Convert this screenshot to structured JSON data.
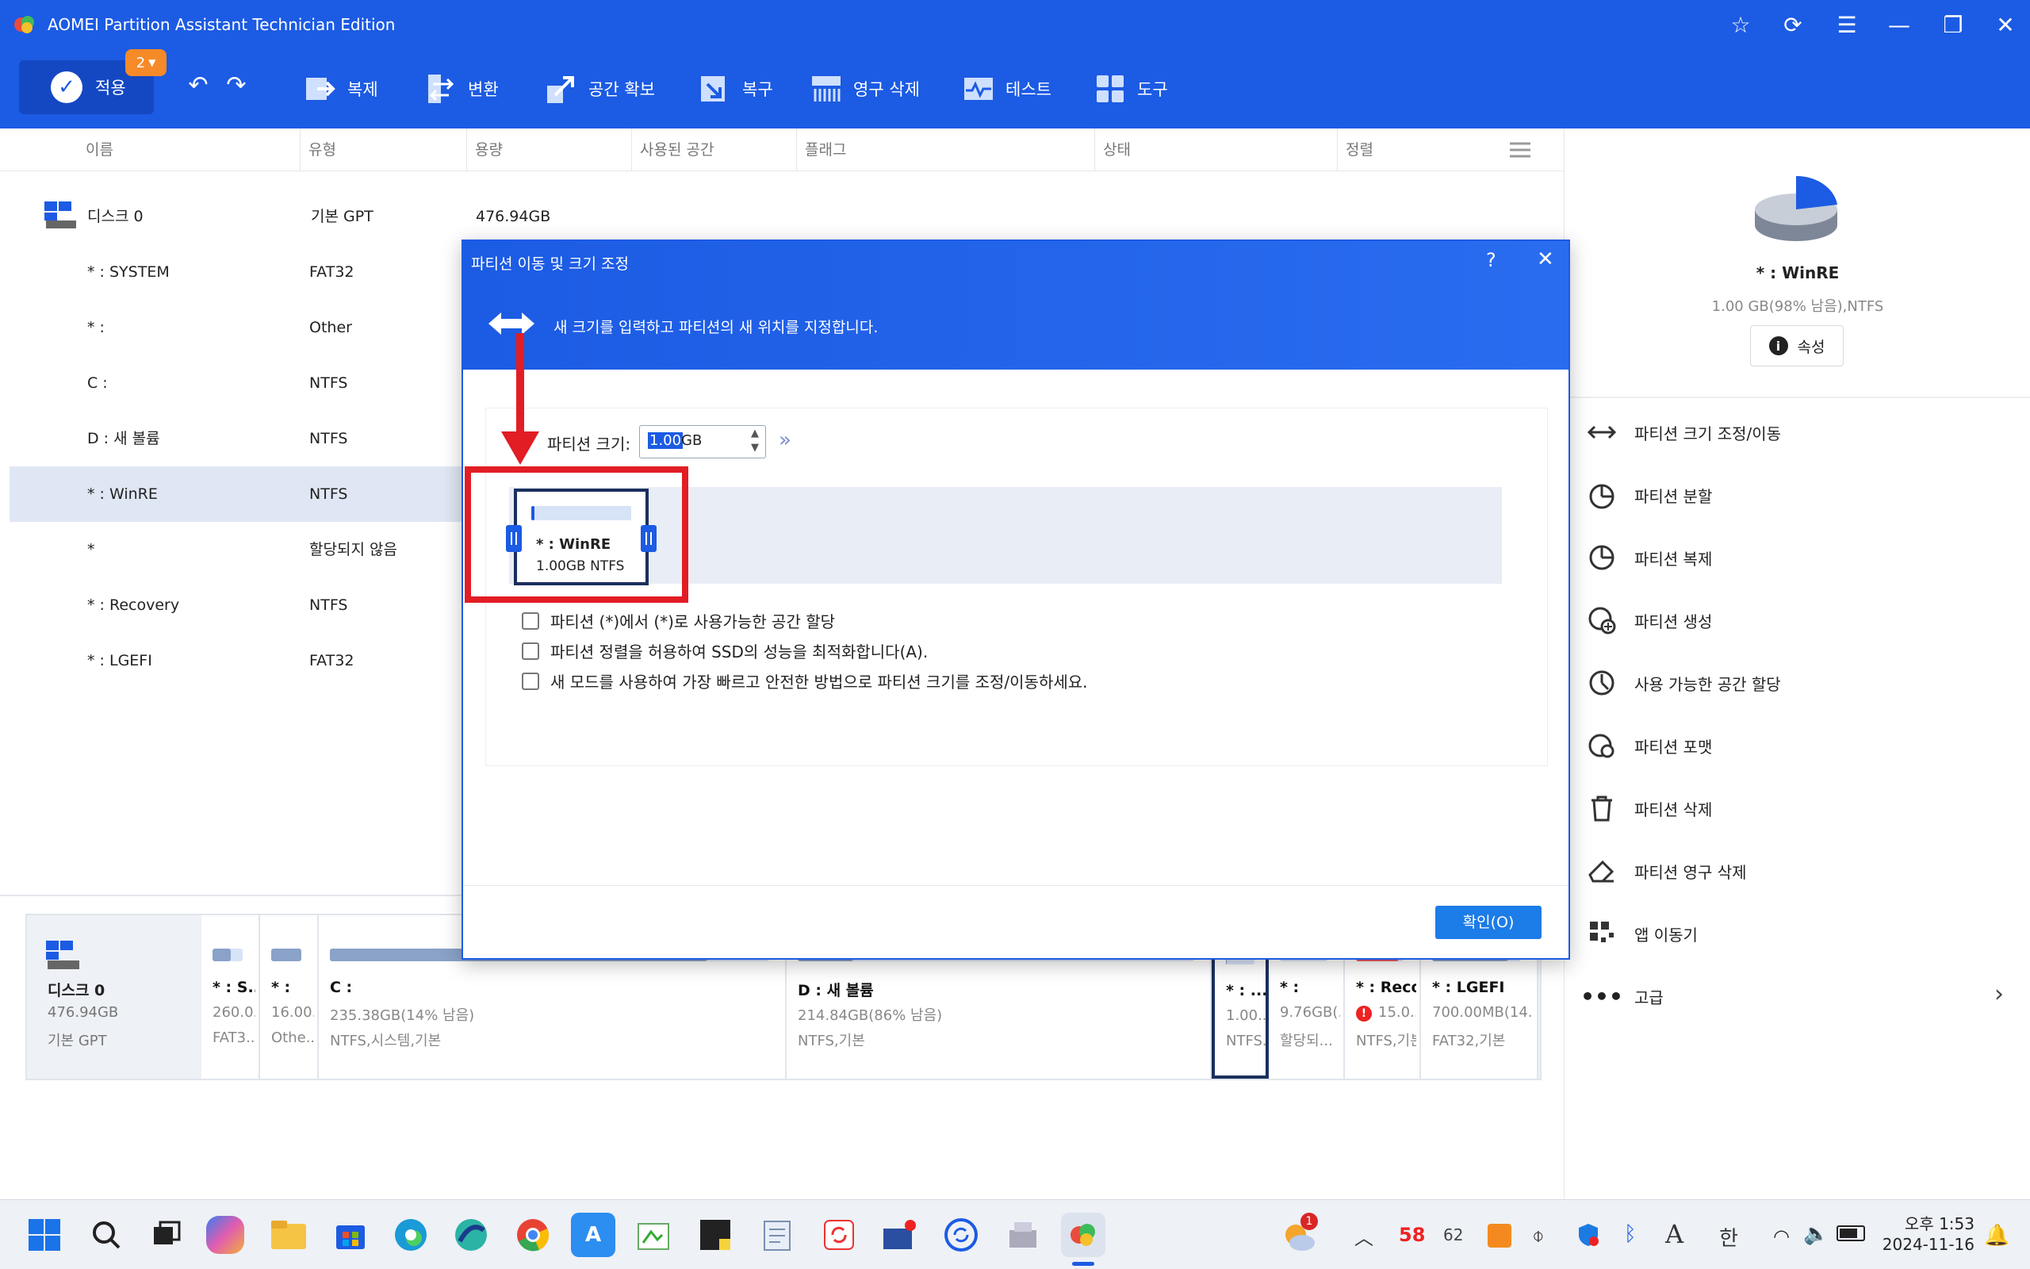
{
  "window": {
    "title": "AOMEI Partition Assistant Technician Edition"
  },
  "toolbar": {
    "apply_label": "적용",
    "apply_badge": "2",
    "items": [
      {
        "label": "복제",
        "icon": "clone-icon"
      },
      {
        "label": "변환",
        "icon": "convert-icon"
      },
      {
        "label": "공간 확보",
        "icon": "free-space-icon"
      },
      {
        "label": "복구",
        "icon": "recovery-icon"
      },
      {
        "label": "영구 삭제",
        "icon": "wipe-icon"
      },
      {
        "label": "테스트",
        "icon": "test-icon"
      },
      {
        "label": "도구",
        "icon": "tools-icon"
      }
    ]
  },
  "table": {
    "columns": [
      "이름",
      "유형",
      "용량",
      "사용된 공간",
      "플래그",
      "상태",
      "정렬"
    ],
    "disk": {
      "name": "디스크 0",
      "type": "기본 GPT",
      "capacity": "476.94GB"
    },
    "rows": [
      {
        "name": "* : SYSTEM",
        "type": "FAT32"
      },
      {
        "name": "* :",
        "type": "Other"
      },
      {
        "name": "C :",
        "type": "NTFS"
      },
      {
        "name": "D : 새 볼륨",
        "type": "NTFS"
      },
      {
        "name": "* : WinRE",
        "type": "NTFS",
        "selected": true
      },
      {
        "name": "*",
        "type": "할당되지 않음"
      },
      {
        "name": "* : Recovery",
        "type": "NTFS"
      },
      {
        "name": "* : LGEFI",
        "type": "FAT32"
      }
    ]
  },
  "side": {
    "partition_name": "* : WinRE",
    "partition_info": "1.00 GB(98% 남음),NTFS",
    "properties_label": "속성",
    "ops": [
      {
        "label": "파티션 크기 조정/이동",
        "icon": "resize-icon"
      },
      {
        "label": "파티션 분할",
        "icon": "split-icon"
      },
      {
        "label": "파티션 복제",
        "icon": "clone-partition-icon"
      },
      {
        "label": "파티션 생성",
        "icon": "create-partition-icon"
      },
      {
        "label": "사용 가능한 공간 할당",
        "icon": "allocate-icon"
      },
      {
        "label": "파티션 포맷",
        "icon": "format-icon"
      },
      {
        "label": "파티션 삭제",
        "icon": "trash-icon"
      },
      {
        "label": "파티션 영구 삭제",
        "icon": "eraser-icon"
      },
      {
        "label": "앱 이동기",
        "icon": "app-mover-icon"
      },
      {
        "label": "고급",
        "icon": "more-icon"
      }
    ]
  },
  "diskmap": {
    "disk": {
      "name": "디스크 0",
      "size": "476.94GB",
      "type": "기본 GPT"
    },
    "segments": [
      {
        "name": "* : S...",
        "l1": "260.0...",
        "l2": "FAT3...",
        "used": 0.6
      },
      {
        "name": "* :",
        "l1": "16.00...",
        "l2": "Othe...",
        "used": 1.0
      },
      {
        "name": "C :",
        "l1": "235.38GB(14% 남음)",
        "l2": "NTFS,시스템,기본",
        "used": 0.86
      },
      {
        "name": "D : 새 볼륨",
        "l1": "214.84GB(86% 남음)",
        "l2": "NTFS,기본",
        "used": 0.14
      },
      {
        "name": "* : ...",
        "l1": "1.00...",
        "l2": "NTFS...",
        "used": 0.02,
        "selected": true
      },
      {
        "name": "* :",
        "l1": "9.76GB(...",
        "l2": "할당되...",
        "used": 0.0
      },
      {
        "name": "* : Reco...",
        "l1": "15.0...",
        "l2": "NTFS,기본",
        "used": 0.9,
        "warn": true
      },
      {
        "name": "* : LGEFI",
        "l1": "700.00MB(14...",
        "l2": "FAT32,기본",
        "used": 0.86
      }
    ]
  },
  "dialog": {
    "title": "파티션 이동 및 크기 조정",
    "subtitle": "새 크기를 입력하고 파티션의 새 위치를 지정합니다.",
    "size_label": "파티션 크기:",
    "size_value_selected": "1.00",
    "size_unit": "GB",
    "block_name": "* : WinRE",
    "block_info": "1.00GB NTFS",
    "block_used": 0.02,
    "options": [
      "파티션 (*)에서 (*)로 사용가능한 공간 할당",
      "파티션 정렬을 허용하여 SSD의 성능을 최적화합니다(A).",
      "새 모드를 사용하여 가장 빠르고 안전한 방법으로 파티션 크기를 조정/이동하세요."
    ],
    "ok_label": "확인(O)"
  },
  "taskbar": {
    "time": "오후 1:53",
    "date": "2024-11-16",
    "lang": "한",
    "font_indicator": "A",
    "temp": "58",
    "weather_badge": "1",
    "tray_num": "62"
  },
  "colors": {
    "accent": "#1c5be3",
    "highlight": "#e21d24",
    "selected_row": "#dfe7f4"
  }
}
